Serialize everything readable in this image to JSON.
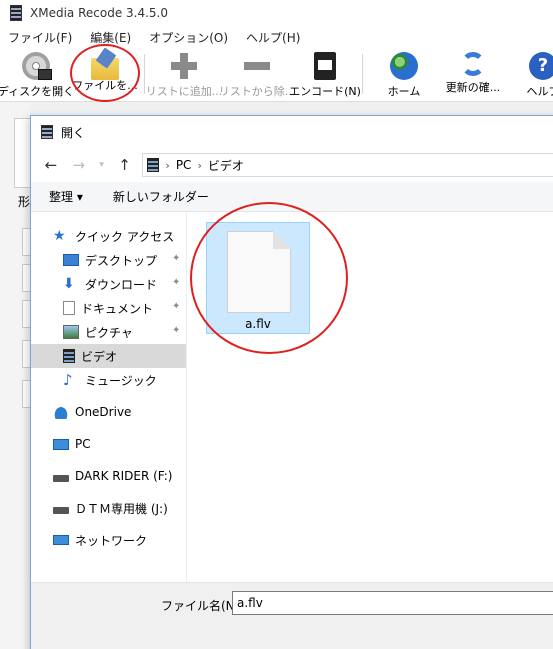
{
  "app": {
    "title": "XMedia Recode 3.4.5.0",
    "menu": [
      "ファイル(F)",
      "編集(E)",
      "オプション(O)",
      "ヘルプ(H)"
    ],
    "toolbar": {
      "open_disc": "ディスクを開く",
      "open_file": "ファイルを...",
      "add_to_list": "リストに追加...",
      "remove_from_list": "リストから除...",
      "encode": "エンコード(N)",
      "home": "ホーム",
      "update_check": "更新の確...",
      "help": "ヘルプ"
    },
    "behind_label": "形"
  },
  "dialog": {
    "title": "開く",
    "address": {
      "crumbs": [
        "PC",
        "ビデオ"
      ]
    },
    "commands": {
      "organize": "整理 ▾",
      "new_folder": "新しいフォルダー"
    },
    "nav": {
      "quick_access": "クイック アクセス",
      "desktop": "デスクトップ",
      "downloads": "ダウンロード",
      "documents": "ドキュメント",
      "pictures": "ピクチャ",
      "videos": "ビデオ",
      "music": "ミュージック",
      "onedrive": "OneDrive",
      "pc": "PC",
      "drive_f": "DARK RIDER (F:)",
      "drive_j": "ＤＴＭ専用機 (J:)",
      "network": "ネットワーク"
    },
    "files": [
      {
        "name": "a.flv"
      }
    ],
    "footer": {
      "filename_label": "ファイル名(N):",
      "filename_value": "a.flv"
    }
  },
  "colors": {
    "annotation": "#e02020",
    "selection": "#cce8ff",
    "accent": "#2b6fd0"
  }
}
